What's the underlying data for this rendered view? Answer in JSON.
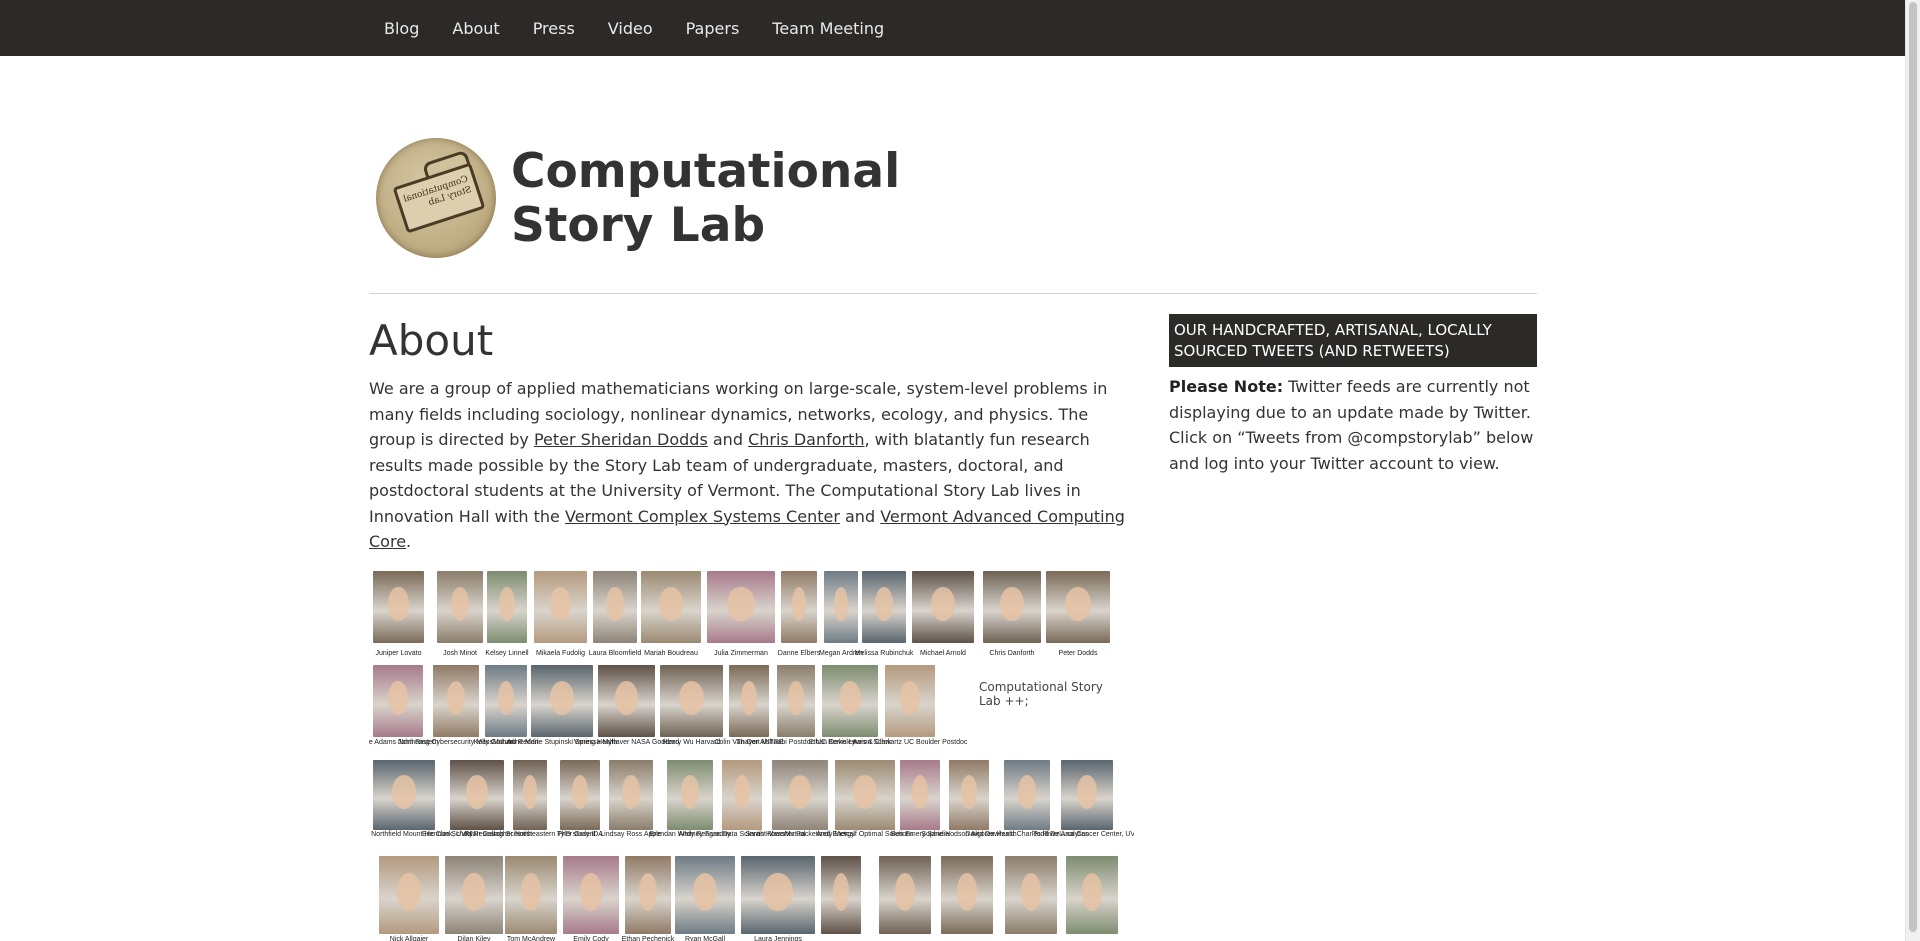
{
  "nav": {
    "items": [
      "Blog",
      "About",
      "Press",
      "Video",
      "Papers",
      "Team Meeting"
    ]
  },
  "header": {
    "title_line1": "Computational",
    "title_line2": "Story Lab",
    "seal_text": "Computational Story Lab"
  },
  "main": {
    "title": "About",
    "intro": {
      "p1": "We are a group of applied mathematicians working on large-scale, system-level problems in many fields including sociology, nonlinear dynamics, networks, ecology, and physics. The group is directed by ",
      "link_dodds": "Peter Sheridan Dodds",
      "and1": " and ",
      "link_danforth": "Chris Danforth",
      "p2": ", with blatantly fun research results made possible by the Story Lab team of undergraduate, masters, doctoral, and postdoctoral students at the University of Vermont. The Computational Story Lab lives in Innovation Hall with the ",
      "link_vcsc": "Vermont Complex Systems Center",
      "and2": " and ",
      "link_vacc": "Vermont Advanced Computing Core",
      "end": "."
    },
    "team_captions": [
      "Juniper Lovato",
      "Josh Minot",
      "Kelsey Linnell",
      "Mikaela Fudolig",
      "Laura Bloomfield",
      "Mariah Boudreau",
      "Julia Zimmerman",
      "Danne Elbers",
      "Megan Ardren",
      "Melissa Rubinchuk",
      "Michael Arnold",
      "Chris Danforth",
      "Peter Dodds",
      "Jane Adams Northeastern",
      "John Ring Cybersecurity MassMutual",
      "Kelly Gothard Reddit",
      "Anne Marie Stupinski Spring Health",
      "Vanessa Myhaver NASA Goddard",
      "Henry Wu Harvard",
      "Colin Van Oort MITRE",
      "Thayer Alshaabi Postdoc UC Berkeley",
      "Ethan Davis Lewis & Clark",
      "Aaron Schwartz UC Boulder Postdoc",
      "Abby Ross Northfield Mount Hermon School",
      "Eric Clark, UVM Research Scientist",
      "Ryan Gallagher Northeastern PhD student",
      "Tyler Gray IDA",
      "Lindsay Ross Apple",
      "Brendan Whitney Faraday",
      "Andy Reagan Data Scientist MassMutual",
      "Sarah Howerter Packetized Energy",
      "Andy Metcalf Optimal Solutions",
      "Ben Emery Sandia",
      "Sophie Hodson Algorex Health",
      "David Dewhurst Charles River Analytics",
      "Todd DeLuca Cancer Center, UVM",
      "Nick Allgaier",
      "Dilan Kiley",
      "Tom McAndrew",
      "Emily Cody",
      "Ethan Pechenick",
      "Ryan McGall",
      "Laura Jennings"
    ],
    "logo_mini": "Computational Story Lab ++;"
  },
  "sidebar": {
    "heading": "OUR HANDCRAFTED, ARTISANAL, LOCALLY SOURCED TWEETS (AND RETWEETS)",
    "note_label": "Please Note:",
    "note_text": " Twitter feeds are currently not displaying due to an update made by Twitter. Click on “Tweets from @compstorylab” below and log into your Twitter account to view."
  },
  "colors": {
    "nav_bg": "#2c2a29",
    "text": "#333333",
    "sidebar_bg": "#2c2a29"
  }
}
